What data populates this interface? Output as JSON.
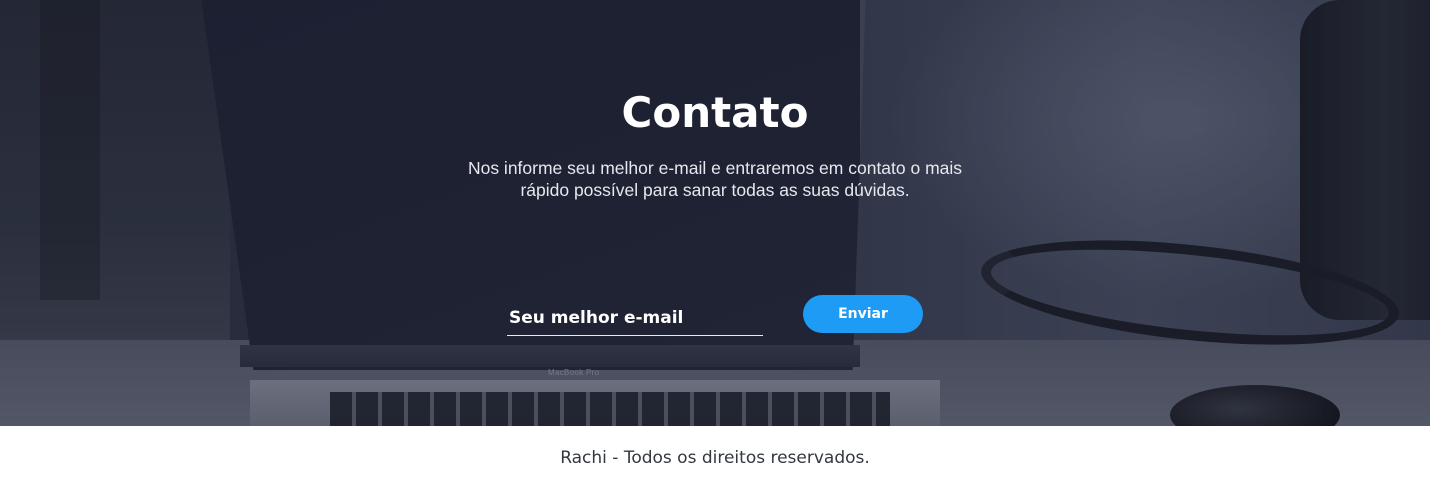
{
  "contact": {
    "title": "Contato",
    "description": "Nos informe seu melhor e-mail e entraremos em contato o mais rápido possível para sanar todas as suas dúvidas.",
    "email_placeholder": "Seu melhor e-mail",
    "submit_label": "Enviar"
  },
  "background": {
    "laptop_brand": "MacBook Pro"
  },
  "footer": {
    "text": "Rachi - Todos os direitos reservados."
  },
  "colors": {
    "accent": "#1e9bf5",
    "footer_text": "#333740"
  }
}
